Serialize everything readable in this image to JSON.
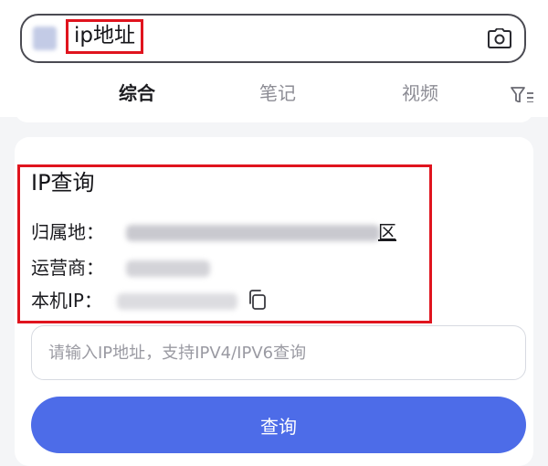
{
  "search": {
    "query": "ip地址",
    "icons": {
      "camera": "camera-icon"
    }
  },
  "tabs": [
    {
      "label": "综合",
      "active": true
    },
    {
      "label": "笔记",
      "active": false
    },
    {
      "label": "视频",
      "active": false
    }
  ],
  "filter": {
    "icon": "filter-icon"
  },
  "ip_card": {
    "title": "IP查询",
    "rows": [
      {
        "label": "归属地：",
        "value_visible_tail": "区",
        "redacted": true
      },
      {
        "label": "运营商：",
        "redacted": true
      },
      {
        "label": "本机IP：",
        "redacted": true,
        "action_icon": "copy-icon"
      }
    ]
  },
  "ip_input": {
    "placeholder": "请输入IP地址，支持IPV4/IPV6查询",
    "value": ""
  },
  "query_button": {
    "label": "查询"
  },
  "colors": {
    "accent": "#4d6ce8",
    "highlight": "#e0141e",
    "text": "#1b1b1f",
    "muted": "#8c8c94",
    "background": "#f4f5f7"
  }
}
